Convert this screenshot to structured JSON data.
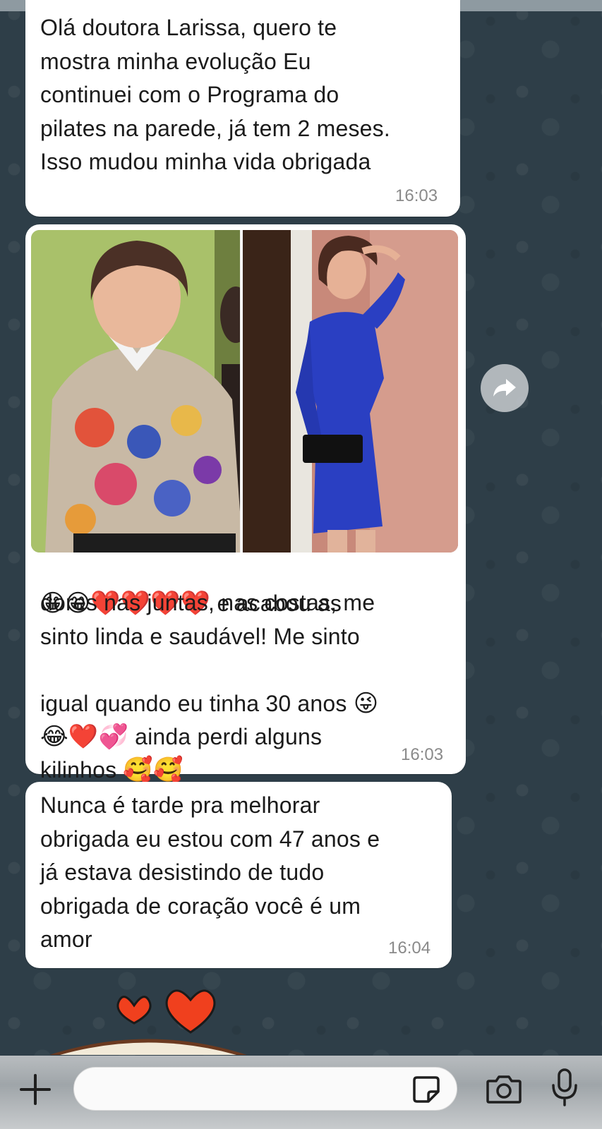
{
  "chat": {
    "messages": [
      {
        "text": "Olá doutora Larissa, quero te\nmostra minha evolução Eu\ncontinuei com o Programa do\npilates na parede, já tem 2 meses.\nIsso mudou minha vida obrigada",
        "time": "16:03"
      },
      {
        "image_alt": "Foto antes e depois",
        "line1_emojis": "😁😁❤️❤️❤️❤️",
        "line1_text": " e acabou as",
        "lines_mid": "dores nas juntas, nas costas, me\nsinto linda e saudável! Me sinto",
        "line4_text": "igual quando eu tinha 30 anos ",
        "line4_emoji": "😜",
        "line5_emojis": "😂❤️💞",
        "line5_text": " ainda perdi alguns",
        "line6_text": "kilinhos ",
        "line6_emojis": "🥰🥰",
        "time": "16:03"
      },
      {
        "text": "Nunca é tarde pra melhorar\nobrigada eu estou com 47 anos e\njá estava desistindo de tudo\nobrigada de coração você é um\namor",
        "time": "16:04"
      }
    ]
  },
  "composer": {
    "placeholder": "",
    "value": ""
  },
  "icons": {
    "plus": "plus-icon",
    "sticker": "sticker-icon",
    "camera": "camera-icon",
    "mic": "microphone-icon",
    "forward": "forward-icon"
  },
  "colors": {
    "wallpaper": "#2e3e48",
    "bubble": "#ffffff",
    "heart": "#e8321a",
    "dress": "#2a3fc2"
  }
}
